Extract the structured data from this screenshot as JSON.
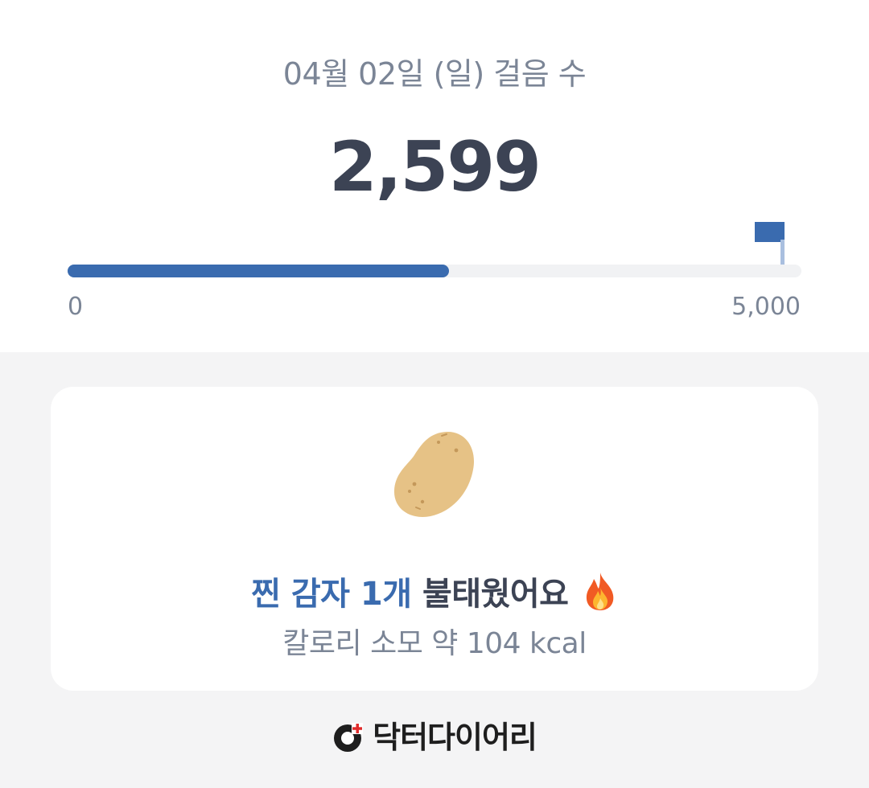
{
  "header": {
    "date_label": "04월 02일 (일) 걸음 수",
    "steps": "2,599"
  },
  "progress": {
    "min_label": "0",
    "max_label": "5,000",
    "value": 2599,
    "goal": 5000,
    "fill_color": "#3a6baf",
    "flag_icon": "goal-flag-icon"
  },
  "summary_card": {
    "image_icon": "potato-icon",
    "headline_accent": "찐 감자 1개",
    "headline_rest": " 불태웠어요 ",
    "headline_emoji_icon": "fire-icon",
    "calorie_text": "칼로리 소모 약 104 kcal"
  },
  "footer": {
    "brand_icon": "doctor-diary-logo-icon",
    "brand_name": "닥터다이어리"
  }
}
